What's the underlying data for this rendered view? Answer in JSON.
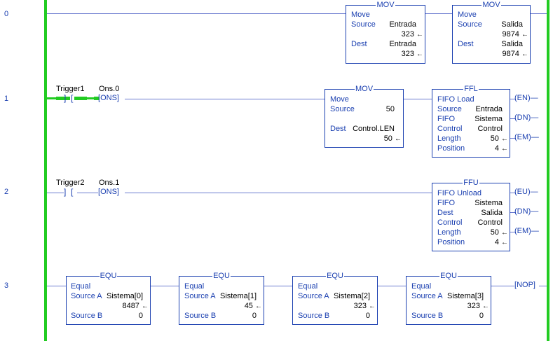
{
  "rungs": [
    {
      "number": "0"
    },
    {
      "number": "1"
    },
    {
      "number": "2"
    },
    {
      "number": "3"
    }
  ],
  "rung0": {
    "mov1": {
      "title": "MOV",
      "name": "Move",
      "source_label": "Source",
      "source_tag": "Entrada",
      "source_val": "323",
      "dest_label": "Dest",
      "dest_tag": "Entrada",
      "dest_val": "323"
    },
    "mov2": {
      "title": "MOV",
      "name": "Move",
      "source_label": "Source",
      "source_tag": "Salida",
      "source_val": "9874",
      "dest_label": "Dest",
      "dest_tag": "Salida",
      "dest_val": "9874"
    }
  },
  "rung1": {
    "contact_tag": "Trigger1",
    "ons_tag": "Ons.0",
    "ons_label": "ONS",
    "mov": {
      "title": "MOV",
      "name": "Move",
      "source_label": "Source",
      "source_val": "50",
      "dest_label": "Dest",
      "dest_tag": "Control.LEN",
      "dest_val": "50"
    },
    "ffl": {
      "title": "FFL",
      "name": "FIFO Load",
      "source_label": "Source",
      "source_tag": "Entrada",
      "fifo_label": "FIFO",
      "fifo_tag": "Sistema",
      "control_label": "Control",
      "control_tag": "Control",
      "length_label": "Length",
      "length_val": "50",
      "position_label": "Position",
      "position_val": "4"
    },
    "outputs": [
      "EN",
      "DN",
      "EM"
    ]
  },
  "rung2": {
    "contact_tag": "Trigger2",
    "ons_tag": "Ons.1",
    "ons_label": "ONS",
    "ffu": {
      "title": "FFU",
      "name": "FIFO Unload",
      "fifo_label": "FIFO",
      "fifo_tag": "Sistema",
      "dest_label": "Dest",
      "dest_tag": "Salida",
      "control_label": "Control",
      "control_tag": "Control",
      "length_label": "Length",
      "length_val": "50",
      "position_label": "Position",
      "position_val": "4"
    },
    "outputs": [
      "EU",
      "DN",
      "EM"
    ]
  },
  "rung3": {
    "equ": [
      {
        "title": "EQU",
        "name": "Equal",
        "a_label": "Source A",
        "a_tag": "Sistema[0]",
        "a_val": "8487",
        "b_label": "Source B",
        "b_val": "0"
      },
      {
        "title": "EQU",
        "name": "Equal",
        "a_label": "Source A",
        "a_tag": "Sistema[1]",
        "a_val": "45",
        "b_label": "Source B",
        "b_val": "0"
      },
      {
        "title": "EQU",
        "name": "Equal",
        "a_label": "Source A",
        "a_tag": "Sistema[2]",
        "a_val": "323",
        "b_label": "Source B",
        "b_val": "0"
      },
      {
        "title": "EQU",
        "name": "Equal",
        "a_label": "Source A",
        "a_tag": "Sistema[3]",
        "a_val": "323",
        "b_label": "Source B",
        "b_val": "0"
      }
    ],
    "nop": "NOP"
  },
  "colors": {
    "rail": "#22cc22",
    "instruction": "#1a3fb0",
    "value": "#000000"
  },
  "icons": {
    "arrow": "left-arrow"
  }
}
